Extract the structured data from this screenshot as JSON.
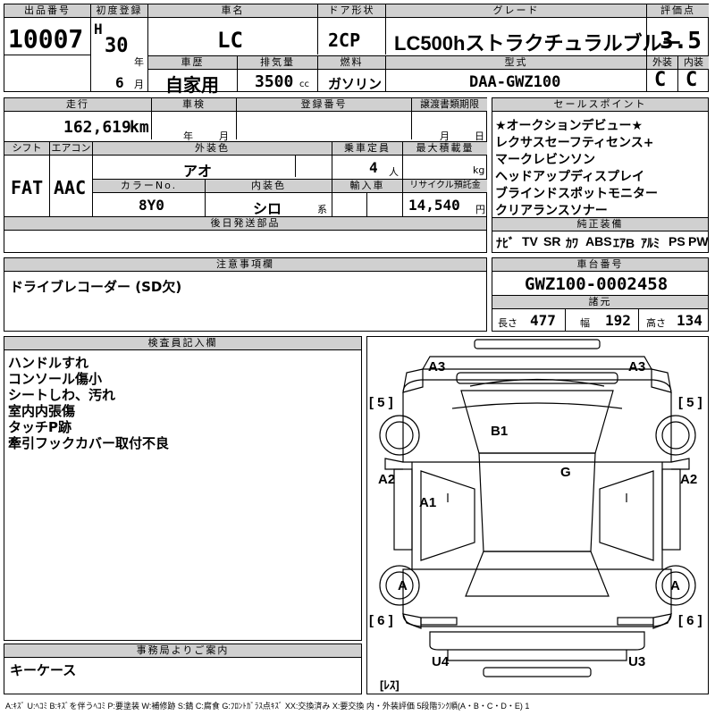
{
  "top": {
    "lot_label": "出品番号",
    "lot_number": "10007",
    "first_reg_label": "初度登録",
    "era": "H",
    "year": "30",
    "year_unit": "年",
    "month": "6",
    "month_unit": "月",
    "car_name_label": "車名",
    "car_name": "LC",
    "door_label": "ドア形状",
    "door": "2CP",
    "grade_label": "グレード",
    "grade": "LC500hストラクチュラルブルー",
    "score_label": "評価点",
    "score": "3.5",
    "history_label": "車歴",
    "history": "自家用",
    "displacement_label": "排気量",
    "displacement": "3500",
    "displacement_unit": "cc",
    "fuel_label": "燃料",
    "fuel": "ガソリン",
    "model_label": "型式",
    "model": "DAA-GWZ100",
    "exterior_label": "外装",
    "exterior": "C",
    "interior_label": "内装",
    "interior": "C"
  },
  "mid": {
    "mileage_label": "走行",
    "mileage": "162,619",
    "mileage_unit": "km",
    "inspection_label": "車検",
    "inspection_year_unit": "年",
    "inspection_month_unit": "月",
    "reg_no_label": "登録番号",
    "transfer_label": "譲渡書類期限",
    "transfer_month_unit": "月",
    "transfer_day_unit": "日",
    "shift_label": "シフト",
    "shift": "FAT",
    "ac_label": "エアコン",
    "ac": "AAC",
    "color_label": "外装色",
    "color": "アオ",
    "capacity_label": "乗車定員",
    "capacity": "4",
    "capacity_unit": "人",
    "load_label": "最大積載量",
    "load_unit": "kg",
    "color_no_label": "カラーNo.",
    "color_no": "8Y0",
    "int_color_label": "内装色",
    "int_color": "シロ",
    "int_color_unit": "系",
    "import_label": "輸入車",
    "recycle_label": "リサイクル預託金",
    "recycle": "14,540",
    "recycle_unit": "円",
    "later_parts_label": "後日発送部品"
  },
  "sales": {
    "title": "セールスポイント",
    "lines": [
      "★オークションデビュー★",
      "レクサスセーフティセンス+",
      "マークレビンソン",
      "ヘッドアップディスプレイ",
      "ブラインドスポットモニター",
      "クリアランスソナー"
    ],
    "equip_title": "純正装備",
    "equip": [
      "ﾅﾋﾞ",
      "TV",
      "SR",
      "ｶﾜ",
      "ABS",
      "ｴｱB",
      "ｱﾙﾐ",
      "PS",
      "PW"
    ]
  },
  "notes": {
    "title": "注意事項欄",
    "text": "ドライブレコーダー (SD欠)"
  },
  "chassis": {
    "title": "車台番号",
    "number": "GWZ100-0002458",
    "spec_title": "諸元",
    "length_label": "長さ",
    "length": "477",
    "width_label": "幅",
    "width": "192",
    "height_label": "高さ",
    "height": "134"
  },
  "inspector": {
    "title": "検査員記入欄",
    "lines": [
      "ハンドルすれ",
      "コンソール傷小",
      "シートしわ、汚れ",
      "室内内張傷",
      "タッチP跡",
      "牽引フックカバー取付不良"
    ]
  },
  "office": {
    "title": "事務局よりご案内",
    "text": "キーケース"
  },
  "diagram": {
    "marks": {
      "a3_left": "A3",
      "a3_right": "A3",
      "five_left": "[ 5 ]",
      "five_right": "[ 5 ]",
      "b1": "B1",
      "g": "G",
      "a2_left": "A2",
      "a2_right": "A2",
      "a1": "A1",
      "a_left": "A",
      "a_right": "A",
      "six_left": "[ 6 ]",
      "six_right": "[ 6 ]",
      "u4": "U4",
      "u3": "U3",
      "less": "[ﾚｽ]"
    }
  },
  "legend": "A:ｷｽﾞ U:ﾍｺﾐ B:ｷｽﾞを伴うﾍｺﾐ P:要塗装 W:補修跡 S:錆 C:腐食 G:ﾌﾛﾝﾄｶﾞﾗｽ点ｷｽﾞ XX:交換済み X:要交換 内・外装評価 5段階ﾗﾝｸ順(A・B・C・D・E) 1"
}
